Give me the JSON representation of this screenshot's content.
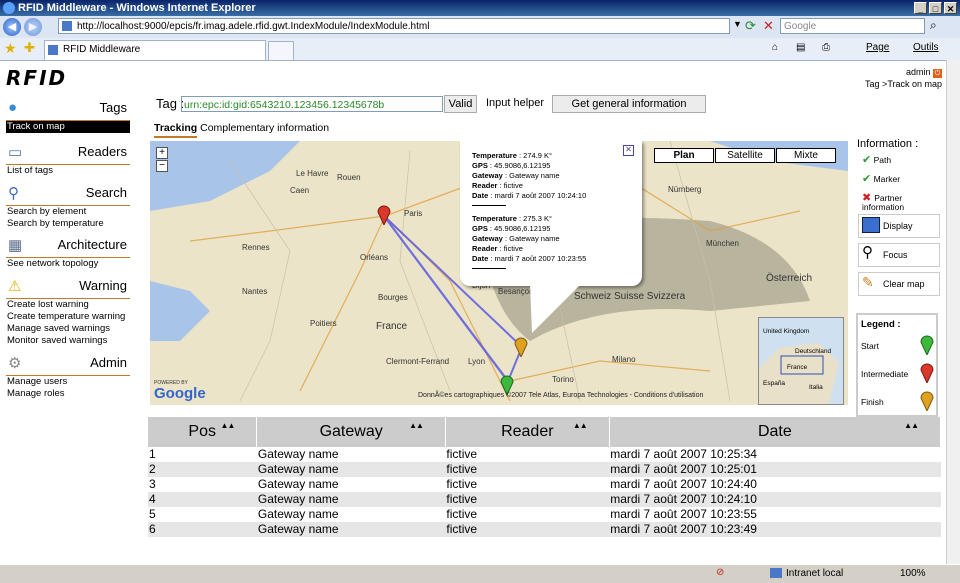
{
  "browser": {
    "title": "RFID Middleware - Windows Internet Explorer",
    "address": "http://localhost:9000/epcis/fr.imag.adele.rfid.gwt.IndexModule/IndexModule.html",
    "search_placeholder": "Google",
    "tab_label": "RFID Middleware",
    "tools": {
      "page": "Page",
      "outils": "Outils"
    },
    "status": {
      "zone": "Intranet local",
      "zoom": "100%"
    }
  },
  "header": {
    "logo": "RFID",
    "user": "admin",
    "breadcrumb": "Tag >Track on map"
  },
  "sidebar": [
    {
      "title": "Tags",
      "icon": "globe-icon",
      "items": [
        "Track on map"
      ]
    },
    {
      "title": "Readers",
      "icon": "reader-icon",
      "items": [
        "List of tags"
      ]
    },
    {
      "title": "Search",
      "icon": "magnifier-icon",
      "items": [
        "Search by element",
        "Search by temperature"
      ]
    },
    {
      "title": "Architecture",
      "icon": "network-icon",
      "items": [
        "See network topology"
      ]
    },
    {
      "title": "Warning",
      "icon": "warning-icon",
      "items": [
        "Create lost warning",
        "Create temperature warning",
        "Manage saved warnings",
        "Monitor saved warnings"
      ]
    },
    {
      "title": "Admin",
      "icon": "admin-icon",
      "items": [
        "Manage users",
        "Manage roles"
      ]
    }
  ],
  "tag": {
    "label": "Tag :",
    "value": "urn:epc:id:gid:6543210.123456.12345678b",
    "valid": "Valid",
    "input_helper": "Input helper",
    "general_info": "Get general information"
  },
  "tabs": [
    "Tracking",
    "Complementary information"
  ],
  "map": {
    "types": [
      "Plan",
      "Satellite",
      "Mixte"
    ],
    "popup": [
      {
        "temperature": "274.9 K°",
        "gps": "45.9086,6.12195",
        "gateway": "Gateway name",
        "reader": "fictive",
        "date": "mardi 7 août 2007 10:24:10"
      },
      {
        "temperature": "275.3 K°",
        "gps": "45.9086,6.12195",
        "gateway": "Gateway name",
        "reader": "fictive",
        "date": "mardi 7 août 2007 10:23:55"
      }
    ],
    "popup_labels": {
      "temperature": "Temperature",
      "gps": "GPS",
      "gateway": "Gateway",
      "reader": "Reader",
      "date": "Date"
    },
    "places": [
      "Paris",
      "Rouen",
      "Le Havre",
      "Caen",
      "Rennes",
      "Nantes",
      "Orléans",
      "Bourges",
      "Lyon",
      "Clermont-Ferrand",
      "France",
      "Schweiz Suisse Svizzera",
      "Österreich",
      "München",
      "Nürnberg",
      "Torino",
      "Milano",
      "Poitiers",
      "Dijon",
      "Besançon"
    ],
    "copyright": "DonnÃ©es cartographiques ©2007 Tele Atlas, Europa Technologies - Conditions d'utilisation",
    "powered": "POWERED BY",
    "google": "Google",
    "overview_labels": [
      "United Kingdom",
      "Deutschland",
      "France",
      "España",
      "Italia"
    ]
  },
  "info": {
    "title": "Information :",
    "items": [
      "Path",
      "Marker",
      "Partner information"
    ],
    "buttons": [
      "Display",
      "Focus",
      "Clear map"
    ]
  },
  "legend": {
    "title": "Legend :",
    "items": [
      "Start",
      "Intermediate",
      "Finish"
    ]
  },
  "table": {
    "headers": [
      "Pos",
      "Gateway",
      "Reader",
      "Date"
    ],
    "rows": [
      [
        "1",
        "Gateway name",
        "fictive",
        "mardi 7 août 2007 10:25:34"
      ],
      [
        "2",
        "Gateway name",
        "fictive",
        "mardi 7 août 2007 10:25:01"
      ],
      [
        "3",
        "Gateway name",
        "fictive",
        "mardi 7 août 2007 10:24:40"
      ],
      [
        "4",
        "Gateway name",
        "fictive",
        "mardi 7 août 2007 10:24:10"
      ],
      [
        "5",
        "Gateway name",
        "fictive",
        "mardi 7 août 2007 10:23:55"
      ],
      [
        "6",
        "Gateway name",
        "fictive",
        "mardi 7 août 2007 10:23:49"
      ]
    ]
  },
  "colors": {
    "accent": "#c07a2a",
    "start": "#3cb83c",
    "intermediate": "#d9382a",
    "finish": "#e0a020",
    "path": "#5a5ae0"
  }
}
